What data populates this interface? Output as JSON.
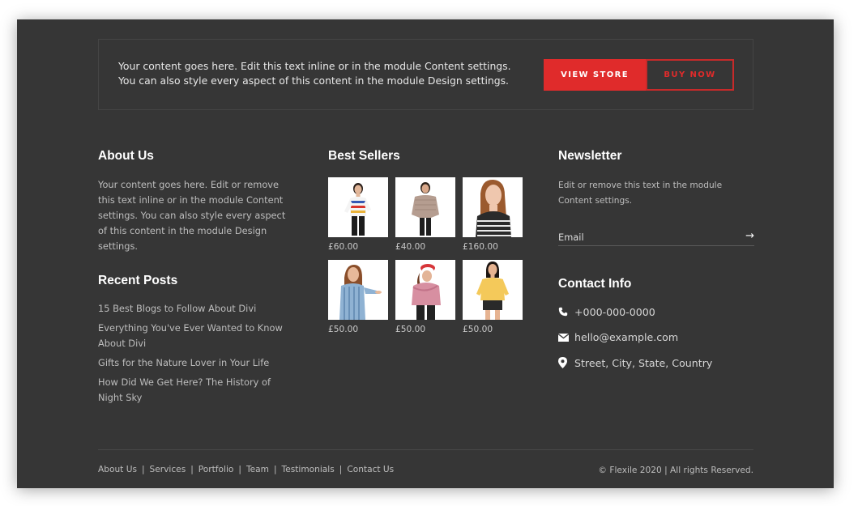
{
  "cta": {
    "line1": "Your content goes here. Edit this text inline or in the module Content settings.",
    "line2": "You can also style every aspect of this content in the module Design settings.",
    "view_store": "VIEW STORE",
    "buy_now": "BUY NOW"
  },
  "about": {
    "title": "About Us",
    "text": "Your content goes here. Edit or remove this text inline or in the module Content settings. You can also style every aspect of this content in the module Design settings."
  },
  "recent": {
    "title": "Recent Posts",
    "posts": [
      "15 Best Blogs to Follow About Divi",
      "Everything You've Ever Wanted to Know About Divi",
      "Gifts for the Nature Lover in Your Life",
      "How Did We Get Here? The History of Night Sky"
    ]
  },
  "bestsellers": {
    "title": "Best Sellers",
    "products": [
      {
        "price": "£60.00"
      },
      {
        "price": "£40.00"
      },
      {
        "price": "£160.00"
      },
      {
        "price": "£50.00"
      },
      {
        "price": "£50.00"
      },
      {
        "price": "£50.00"
      }
    ]
  },
  "newsletter": {
    "title": "Newsletter",
    "text": "Edit or remove this text in the module Content settings.",
    "email_placeholder": "Email",
    "submit_arrow": "→"
  },
  "contact": {
    "title": "Contact Info",
    "phone": "+000-000-0000",
    "email": "hello@example.com",
    "address": "Street, City, State, Country"
  },
  "footer": {
    "links": [
      "About Us",
      "Services",
      "Portfolio",
      "Team",
      "Testimonials",
      "Contact Us"
    ],
    "separator": "|",
    "copyright": "© Flexile 2020 | All rights Reserved."
  },
  "colors": {
    "background": "#363636",
    "accent": "#e02b2b"
  }
}
